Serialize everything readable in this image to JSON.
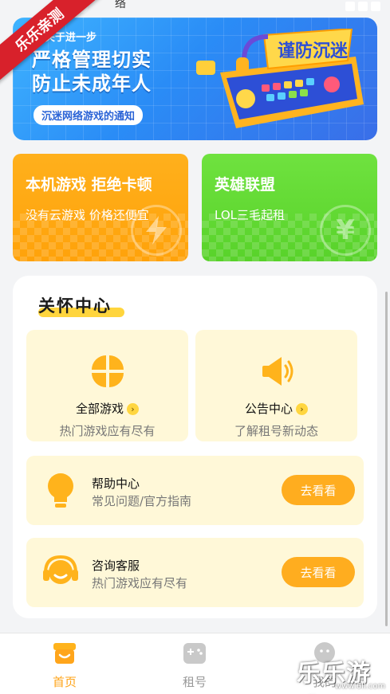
{
  "status_bar": {
    "text": "络"
  },
  "watermark": {
    "corner": "乐乐亲测",
    "site": "乐乐游戏",
    "url": "www.6ll.com"
  },
  "banner": {
    "top_text": "关于进一步",
    "title_line1": "严格管理切实",
    "title_line2": "防止未成年人",
    "tag": "沉迷网络游戏的通知",
    "art_text": "谨防沉迷"
  },
  "cards": [
    {
      "title": "本机游戏 拒绝卡顿",
      "subtitle": "没有云游戏 价格还便宜",
      "badge_icon": "lightning-icon"
    },
    {
      "title": "英雄联盟",
      "subtitle": "LOL三毛起租",
      "badge_icon": "yen-coin-icon",
      "badge_glyph": "¥"
    }
  ],
  "care_center": {
    "title": "关怀中心",
    "tiles": [
      {
        "label": "全部游戏",
        "subtitle": "热门游戏应有尽有",
        "icon": "four-leaf-grid-icon"
      },
      {
        "label": "公告中心",
        "subtitle": "了解租号新动态",
        "icon": "speaker-icon"
      }
    ],
    "rows": [
      {
        "title": "帮助中心",
        "subtitle": "常见问题/官方指南",
        "button": "去看看",
        "icon": "lightbulb-icon"
      },
      {
        "title": "咨询客服",
        "subtitle": "热门游戏应有尽有",
        "button": "去看看",
        "icon": "headset-icon"
      }
    ]
  },
  "tabbar": {
    "items": [
      {
        "label": "首页",
        "icon": "home-shop-icon",
        "active": true
      },
      {
        "label": "租号",
        "icon": "gamepad-icon",
        "active": false
      },
      {
        "label": "我的",
        "icon": "profile-icon",
        "active": false
      }
    ]
  },
  "colors": {
    "accent": "#ffa51b",
    "tile_bg": "#fff8d8",
    "orange_card": "#ffa20a",
    "green_card": "#58d22a",
    "banner_blue": "#2a8cf6"
  }
}
